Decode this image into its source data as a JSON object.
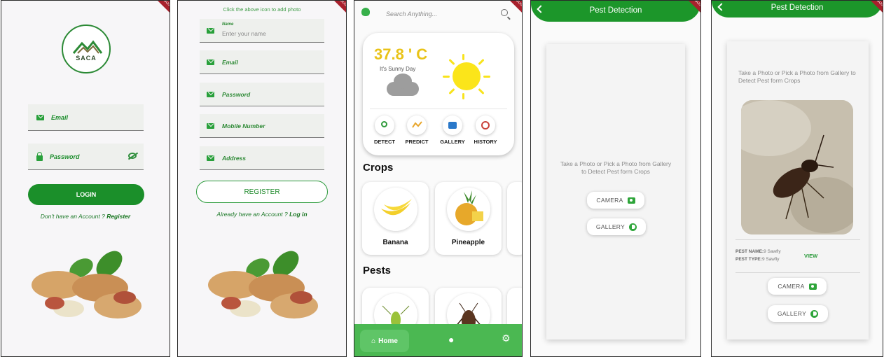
{
  "badge": {
    "debug": "DEBUG"
  },
  "login": {
    "logo_text": "SACA",
    "email_label": "Email",
    "password_label": "Password",
    "login_button": "LOGIN",
    "no_account_text": "Don't have an Account ? ",
    "register_link": "Register"
  },
  "register": {
    "hint": "Click the above icon to add photo",
    "name_label": "Name",
    "name_placeholder": "Enter your name",
    "email_label": "Email",
    "password_label": "Password",
    "mobile_label": "Mobile Number",
    "address_label": "Address",
    "register_button": "REGISTER",
    "have_account_text": "Already have an Account ? ",
    "login_link": "Log in"
  },
  "home": {
    "search_placeholder": "Search Anything...",
    "temperature": "37.8 ' C",
    "condition": "It's Sunny Day",
    "actions": [
      {
        "label": "DETECT",
        "icon": "search-icon"
      },
      {
        "label": "PREDICT",
        "icon": "trend-icon"
      },
      {
        "label": "GALLERY",
        "icon": "camera-icon"
      },
      {
        "label": "HISTORY",
        "icon": "history-icon"
      }
    ],
    "crops_title": "Crops",
    "crops": [
      "Banana",
      "Pineapple"
    ],
    "pests_title": "Pests",
    "nav_home": "Home",
    "colors": {
      "accent": "#1b8f2a",
      "nav": "#4bb852",
      "sun": "#fbe51a",
      "temp": "#e9c318"
    }
  },
  "pest_empty": {
    "title": "Pest Detection",
    "instruction": "Take a Photo or Pick a Photo from Gallery to Detect Pest form Crops",
    "camera_button": "CAMERA",
    "gallery_button": "GALLERY"
  },
  "pest_result": {
    "title": "Pest Detection",
    "instruction": "Take a Photo or Pick a Photo from Gallery to Detect Pest form Crops",
    "pest_name_label": "PEST NAME:",
    "pest_name_value": "9 Sawfly",
    "pest_type_label": "PEST TYPE:",
    "pest_type_value": "9 Sawfly",
    "view_link": "VIEW",
    "camera_button": "CAMERA",
    "gallery_button": "GALLERY"
  }
}
